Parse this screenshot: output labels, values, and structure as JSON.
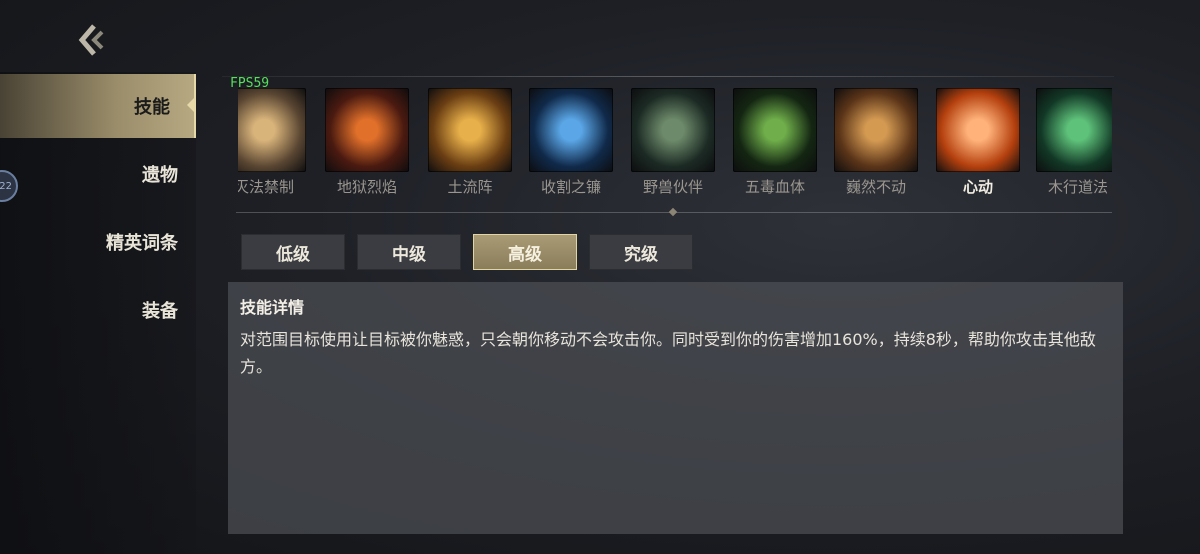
{
  "sidebar": {
    "items": [
      {
        "label": "技能",
        "active": true
      },
      {
        "label": "遗物",
        "active": false
      },
      {
        "label": "精英词条",
        "active": false
      },
      {
        "label": "装备",
        "active": false
      }
    ],
    "avatar_badge": "22"
  },
  "fps": "FPS59",
  "skills": [
    {
      "name": "灭法禁制",
      "icon": "arcane-seal-icon",
      "colors": [
        "#d8b37a",
        "#5a4632"
      ]
    },
    {
      "name": "地狱烈焰",
      "icon": "hellfire-icon",
      "colors": [
        "#e0702a",
        "#4a1a10"
      ]
    },
    {
      "name": "土流阵",
      "icon": "earth-ring-icon",
      "colors": [
        "#e8b04a",
        "#6a3e12"
      ]
    },
    {
      "name": "收割之镰",
      "icon": "reaper-scythe-icon",
      "colors": [
        "#5aa6e6",
        "#102a4a"
      ]
    },
    {
      "name": "野兽伙伴",
      "icon": "beast-companion-icon",
      "colors": [
        "#6d8a6a",
        "#1c2a24"
      ]
    },
    {
      "name": "五毒血体",
      "icon": "poison-body-icon",
      "colors": [
        "#6fae4a",
        "#142612"
      ]
    },
    {
      "name": "巍然不动",
      "icon": "stone-shield-icon",
      "colors": [
        "#d49a52",
        "#5a3418"
      ]
    },
    {
      "name": "心动",
      "icon": "heart-charm-icon",
      "colors": [
        "#ffb27a",
        "#b4400e"
      ],
      "selected": true
    },
    {
      "name": "木行道法",
      "icon": "wood-vortex-icon",
      "colors": [
        "#5ec27a",
        "#123826"
      ]
    }
  ],
  "tiers": [
    {
      "label": "低级",
      "active": false
    },
    {
      "label": "中级",
      "active": false
    },
    {
      "label": "高级",
      "active": true
    },
    {
      "label": "究级",
      "active": false
    }
  ],
  "detail": {
    "title": "技能详情",
    "text": "对范围目标使用让目标被你魅惑，只会朝你移动不会攻击你。同时受到你的伤害增加160%，持续8秒，帮助你攻击其他敌方。"
  },
  "colors": {
    "accent_gold": "#e7d8a8",
    "fps_green": "#55e05b"
  }
}
